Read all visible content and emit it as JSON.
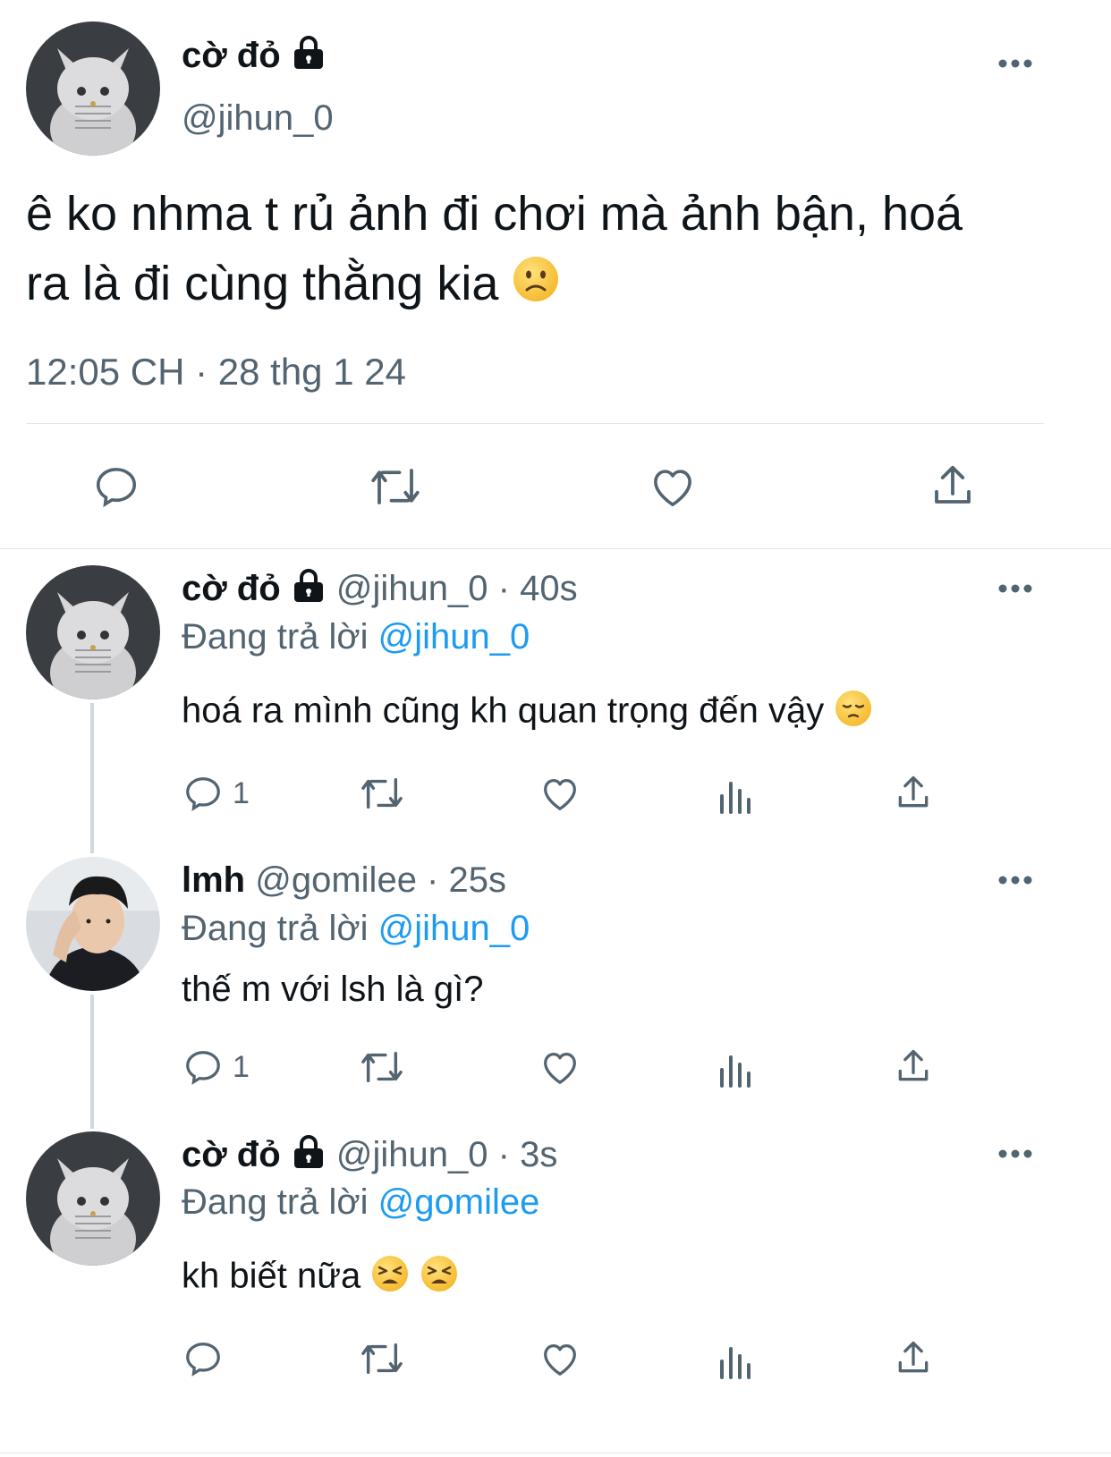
{
  "main_tweet": {
    "display_name": "cờ đỏ",
    "handle": "@jihun_0",
    "text": "ê ko nhma t rủ ảnh đi chơi mà ảnh bận, hoá",
    "text_line2": "ra là đi cùng thằng kia",
    "timestamp": "12:05 CH · 28 thg 1 24"
  },
  "replies": [
    {
      "display_name": "cờ đỏ",
      "meta": "@jihun_0 · 40s",
      "replying_prefix": "Đang trả lời",
      "replying_to": "@jihun_0",
      "text": "hoá ra mình cũng kh quan trọng đến vậy",
      "reply_count": "1"
    },
    {
      "display_name": "lmh",
      "meta": "@gomilee · 25s",
      "replying_prefix": "Đang trả lời",
      "replying_to": "@jihun_0",
      "text": "thế m với lsh là gì?",
      "reply_count": "1"
    },
    {
      "display_name": "cờ đỏ",
      "meta": "@jihun_0 · 3s",
      "replying_prefix": "Đang trả lời",
      "replying_to": "@gomilee",
      "text": "kh biết nữa",
      "reply_count": ""
    }
  ],
  "icons": {
    "lock": "lock-icon",
    "more": "more-icon",
    "reply": "reply-icon",
    "retweet": "retweet-icon",
    "like": "like-icon",
    "views": "views-icon",
    "share": "share-icon",
    "slightly_frowning": "slightly-frowning-face-emoji",
    "pensive": "pensive-face-emoji",
    "weary": "weary-face-emoji"
  },
  "colors": {
    "text": "#0f1419",
    "muted": "#536471",
    "link": "#1d9bf0",
    "divider": "#e1e8ed",
    "thread_line": "#cfd9de"
  }
}
